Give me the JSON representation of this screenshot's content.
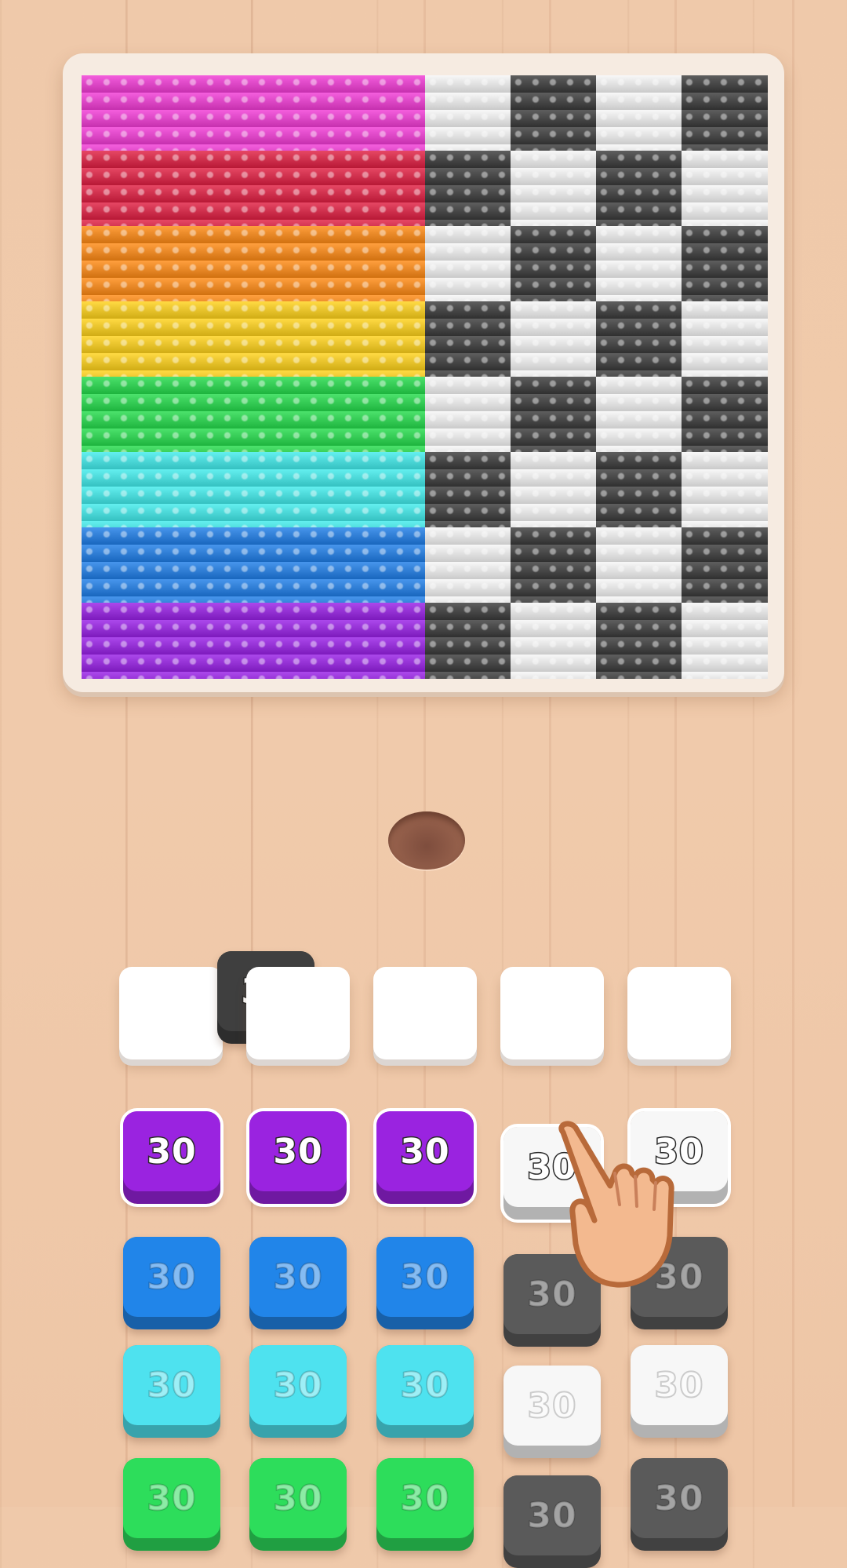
{
  "art": {
    "rainbow_rows": [
      "#f23ad6",
      "#e11f42",
      "#ff8a14",
      "#ffd21a",
      "#24dc4c",
      "#41ecec",
      "#1f7ee8",
      "#9820e6"
    ],
    "checker_colors": {
      "dark": "#3a3a3a",
      "light": "#f6f6f6"
    }
  },
  "queue_slots": [
    {
      "tile": {
        "label": "30",
        "color": "#3f3f3f"
      }
    },
    {
      "tile": null
    },
    {
      "tile": null
    },
    {
      "tile": null
    },
    {
      "tile": null
    }
  ],
  "tile_grid": {
    "columns": [
      [
        {
          "label": "30",
          "color": "#9a23e0",
          "state": "active"
        },
        {
          "label": "30",
          "color": "#2185e9",
          "state": "faded"
        },
        {
          "label": "30",
          "color": "#4ee2ef",
          "state": "faded"
        },
        {
          "label": "30",
          "color": "#2ddd5b",
          "state": "faded"
        }
      ],
      [
        {
          "label": "30",
          "color": "#9a23e0",
          "state": "active"
        },
        {
          "label": "30",
          "color": "#2185e9",
          "state": "faded"
        },
        {
          "label": "30",
          "color": "#4ee2ef",
          "state": "faded"
        },
        {
          "label": "30",
          "color": "#2ddd5b",
          "state": "faded"
        }
      ],
      [
        {
          "label": "30",
          "color": "#9a23e0",
          "state": "active"
        },
        {
          "label": "30",
          "color": "#2185e9",
          "state": "faded"
        },
        {
          "label": "30",
          "color": "#4ee2ef",
          "state": "faded"
        },
        {
          "label": "30",
          "color": "#2ddd5b",
          "state": "faded"
        }
      ],
      [
        {
          "label": "30",
          "color": "#f7f7f7",
          "state": "active"
        },
        {
          "label": "30",
          "color": "#5a5a5a",
          "state": "faded"
        },
        {
          "label": "30",
          "color": "#f7f7f7",
          "state": "faded"
        },
        {
          "label": "30",
          "color": "#5a5a5a",
          "state": "faded"
        }
      ],
      [
        {
          "label": "30",
          "color": "#f7f7f7",
          "state": "active"
        },
        {
          "label": "30",
          "color": "#5a5a5a",
          "state": "faded"
        },
        {
          "label": "30",
          "color": "#f7f7f7",
          "state": "faded"
        },
        {
          "label": "30",
          "color": "#5a5a5a",
          "state": "faded"
        }
      ]
    ]
  },
  "tutorial": {
    "icon": "pointing-hand-icon"
  }
}
